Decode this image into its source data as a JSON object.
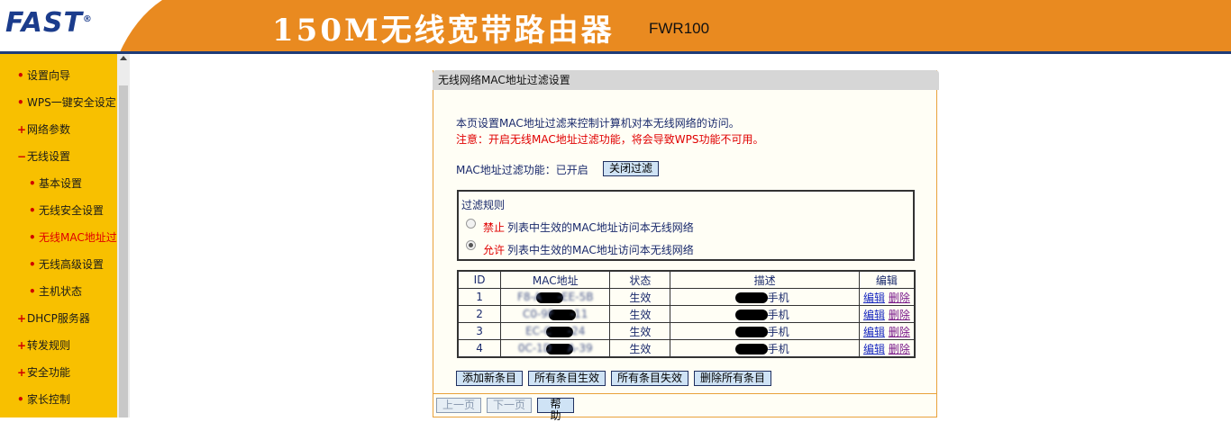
{
  "header": {
    "brand": "FAST",
    "title": "150M无线宽带路由器",
    "model": "FWR100"
  },
  "sidebar": {
    "items": [
      {
        "label": "设置向导",
        "bullet": "•"
      },
      {
        "label": "WPS一键安全设定",
        "bullet": "•"
      },
      {
        "label": "网络参数",
        "bullet": "+"
      },
      {
        "label": "无线设置",
        "bullet": "−"
      },
      {
        "label": "基本设置",
        "bullet": "•"
      },
      {
        "label": "无线安全设置",
        "bullet": "•"
      },
      {
        "label": "无线MAC地址过",
        "bullet": "•"
      },
      {
        "label": "无线高级设置",
        "bullet": "•"
      },
      {
        "label": "主机状态",
        "bullet": "•"
      },
      {
        "label": "DHCP服务器",
        "bullet": "+"
      },
      {
        "label": "转发规则",
        "bullet": "+"
      },
      {
        "label": "安全功能",
        "bullet": "+"
      },
      {
        "label": "家长控制",
        "bullet": "•"
      }
    ]
  },
  "panel": {
    "title": "无线网络MAC地址过滤设置",
    "desc": "本页设置MAC地址过滤来控制计算机对本无线网络的访问。",
    "note": "注意：开启无线MAC地址过滤功能，将会导致WPS功能不可用。",
    "status_label": "MAC地址过滤功能：已开启",
    "toggle_button": "关闭过滤",
    "rules": {
      "legend": "过滤规则",
      "deny_keyword": "禁止",
      "deny_text": "列表中生效的MAC地址访问本无线网络",
      "allow_keyword": "允许",
      "allow_text": "列表中生效的MAC地址访问本无线网络",
      "selected": "allow"
    },
    "table": {
      "headers": [
        "ID",
        "MAC地址",
        "状态",
        "描述",
        "编辑"
      ],
      "rows": [
        {
          "id": "1",
          "mac_left": "F8-A",
          "mac_right": "-EE-5B",
          "status": "生效",
          "desc": "手机",
          "edit": "编辑",
          "delete": "删除"
        },
        {
          "id": "2",
          "mac_left": "C0-9F",
          "mac_right": "-11",
          "status": "生效",
          "desc": "手机",
          "edit": "编辑",
          "delete": "删除"
        },
        {
          "id": "3",
          "mac_left": "EC-C",
          "mac_right": "-24",
          "status": "生效",
          "desc": "手机",
          "edit": "编辑",
          "delete": "删除"
        },
        {
          "id": "4",
          "mac_left": "0C-1D",
          "mac_right": "A-39",
          "status": "生效",
          "desc": "手机",
          "edit": "编辑",
          "delete": "删除"
        }
      ]
    },
    "actions": {
      "add": "添加新条目",
      "enable_all": "所有条目生效",
      "disable_all": "所有条目失效",
      "delete_all": "删除所有条目"
    },
    "pager": {
      "prev": "上一页",
      "next": "下一页",
      "help": "帮 助"
    }
  }
}
